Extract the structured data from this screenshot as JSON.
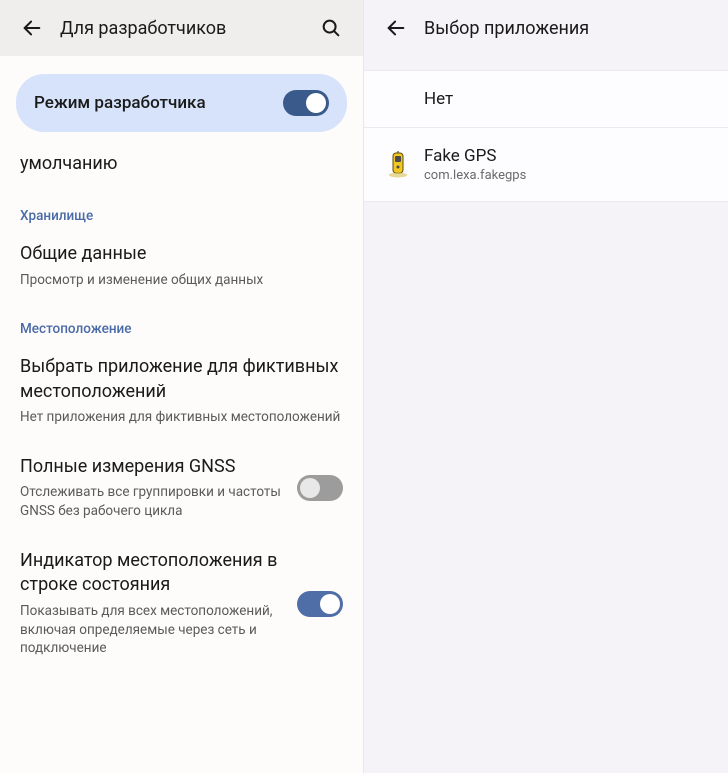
{
  "left": {
    "header_title": "Для разработчиков",
    "dev_mode_label": "Режим разработчика",
    "truncated_row": "умолчанию",
    "section_storage": "Хранилище",
    "storage_row": {
      "title": "Общие данные",
      "sub": "Просмотр и изменение общих данных"
    },
    "section_location": "Местоположение",
    "mock_row": {
      "title": "Выбрать приложение для фиктивных местоположений",
      "sub": "Нет приложения для фиктивных местоположений"
    },
    "gnss_row": {
      "title": "Полные измерения GNSS",
      "sub": "Отслеживать все группировки и частоты GNSS без рабочего цикла"
    },
    "indicator_row": {
      "title": "Индикатор местоположения в строке состояния",
      "sub": "Показывать для всех местоположений, включая определяемые через сеть и подключение"
    }
  },
  "right": {
    "header_title": "Выбор приложения",
    "none_label": "Нет",
    "app": {
      "name": "Fake GPS",
      "package": "com.lexa.fakegps"
    }
  }
}
